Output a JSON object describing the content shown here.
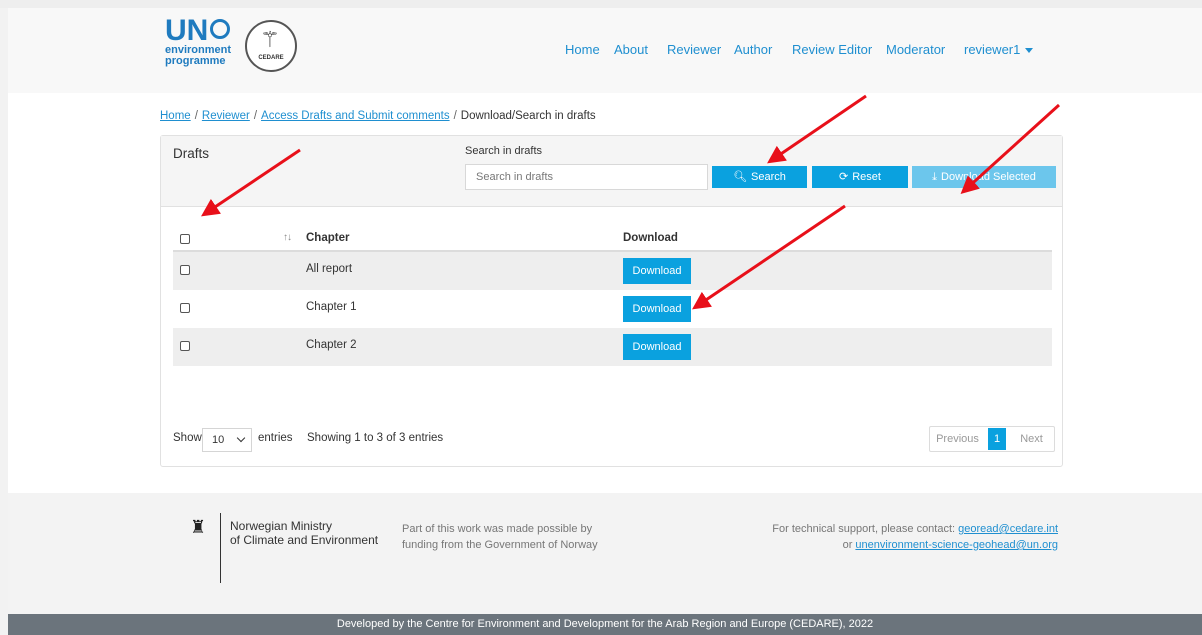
{
  "header": {
    "logo": {
      "un": "UN",
      "line1": "environment",
      "line2": "programme",
      "partner": "CEDARE"
    },
    "nav": [
      "Home",
      "About",
      "Reviewer",
      "Author",
      "Review Editor",
      "Moderator"
    ],
    "user_menu": "reviewer1"
  },
  "breadcrumb": {
    "items": [
      "Home",
      "Reviewer",
      "Access Drafts and Submit comments"
    ],
    "current": "Download/Search in drafts",
    "separator": "/"
  },
  "card": {
    "title": "Drafts",
    "search_label": "Search in drafts",
    "search_placeholder": "Search in drafts",
    "search_value": "",
    "buttons": {
      "search": "Search",
      "reset": "Reset",
      "download_selected": "Download Selected"
    }
  },
  "table": {
    "columns": {
      "chapter": "Chapter",
      "download": "Download"
    },
    "sort_glyph": "↑↓",
    "rows": [
      {
        "chapter": "All report",
        "action": "Download"
      },
      {
        "chapter": "Chapter 1",
        "action": "Download"
      },
      {
        "chapter": "Chapter 2",
        "action": "Download"
      }
    ]
  },
  "table_footer": {
    "show": "Show",
    "page_size": "10",
    "entries": "entries",
    "summary": "Showing 1 to 3 of 3 entries",
    "previous": "Previous",
    "current_page": "1",
    "next": "Next"
  },
  "footer": {
    "ministry_line1": "Norwegian Ministry",
    "ministry_line2": "of Climate and Environment",
    "funding_line1": "Part of this work was made possible by",
    "funding_line2": "funding from the Government of Norway",
    "support_prefix": "For technical support, please contact:",
    "support_email1": "georead@cedare.int",
    "support_or": "or",
    "support_email2": "unenvironment-science-geohead@un.org",
    "bottom": "Developed by the Centre for Environment and Development for the Arab Region and Europe (CEDARE), 2022"
  },
  "colors": {
    "accent": "#0aa1df",
    "link": "#1f8fd0",
    "annotation": "#e8101a"
  }
}
